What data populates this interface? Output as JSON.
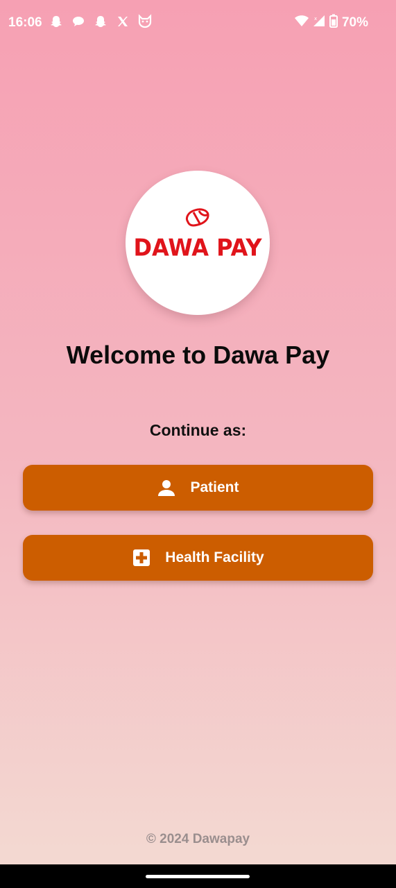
{
  "status_bar": {
    "time": "16:06",
    "battery": "70%",
    "notification_icons": [
      "snapchat-icon",
      "chat-bubble-icon",
      "snapchat-icon",
      "x-icon",
      "cat-icon"
    ],
    "system_icons": [
      "wifi-icon",
      "signal-icon",
      "battery-icon"
    ]
  },
  "logo": {
    "text": "DAWA PAY",
    "color": "#e0141b"
  },
  "welcome": {
    "title": "Welcome to Dawa Pay"
  },
  "role_select": {
    "prompt": "Continue as:",
    "buttons": [
      {
        "label": "Patient",
        "icon": "person-icon"
      },
      {
        "label": "Health Facility",
        "icon": "medical-cross-icon"
      }
    ],
    "button_color": "#cc5d00"
  },
  "footer": {
    "text": "© 2024 Dawapay"
  }
}
